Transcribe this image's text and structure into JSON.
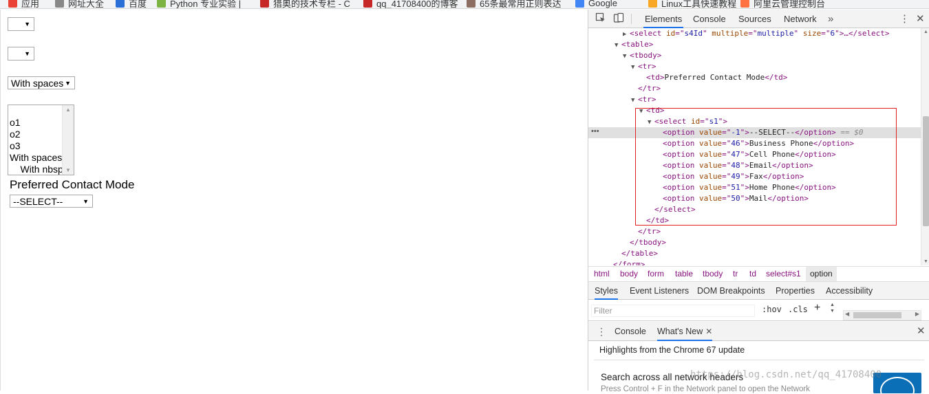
{
  "bookmarks": [
    {
      "label": "应用",
      "icon": "apps-icon"
    },
    {
      "label": "网址大全",
      "icon": "page-icon"
    },
    {
      "label": "百度",
      "icon": "baidu-icon"
    },
    {
      "label": "Python 专业实验 |",
      "icon": "python-icon"
    },
    {
      "label": "猎奥的技术专栏 - C",
      "icon": "csdn-icon"
    },
    {
      "label": "qq_41708400的博客",
      "icon": "csdn-icon"
    },
    {
      "label": "65条最常用正则表达",
      "icon": "bookmark-icon"
    },
    {
      "label": "Google",
      "icon": "google-icon"
    },
    {
      "label": "Linux工具快速教程",
      "icon": "folder-icon"
    },
    {
      "label": "阿里云管理控制台",
      "icon": "aliyun-icon"
    }
  ],
  "page": {
    "select1": {
      "value": ""
    },
    "select2": {
      "value": ""
    },
    "select3": {
      "value": "With spaces"
    },
    "listbox": {
      "options": [
        "",
        "o1",
        "o2",
        "o3",
        "With spaces",
        "    With nbsp"
      ]
    },
    "label": "Preferred Contact Mode",
    "select_mode": {
      "value": "--SELECT--"
    }
  },
  "devtools": {
    "tabs": [
      "Elements",
      "Console",
      "Sources",
      "Network"
    ],
    "active_tab": "Elements",
    "more_label": "»",
    "kebab_label": "⋮",
    "close_label": "✕",
    "dom_lines": [
      {
        "indent": 4,
        "tri": "▶",
        "tag_open": "<select ",
        "attrs": [
          [
            "id",
            "s4Id"
          ],
          [
            "multiple",
            "multiple"
          ],
          [
            "size",
            "6"
          ]
        ],
        "tail": ">…</select>"
      },
      {
        "indent": 3,
        "tri": "▼",
        "tag_open": "<table>",
        "attrs": [],
        "tail": ""
      },
      {
        "indent": 4,
        "tri": "▼",
        "tag_open": "<tbody>",
        "attrs": [],
        "tail": ""
      },
      {
        "indent": 5,
        "tri": "▼",
        "tag_open": "<tr>",
        "attrs": [],
        "tail": ""
      },
      {
        "indent": 6,
        "tri": "",
        "tag_open": "<td>",
        "attrs": [],
        "text": "Preferred Contact Mode",
        "tail": "</td>"
      },
      {
        "indent": 5,
        "tri": "",
        "tag_open": "</tr>",
        "attrs": [],
        "tail": ""
      },
      {
        "indent": 5,
        "tri": "▼",
        "tag_open": "<tr>",
        "attrs": [],
        "tail": ""
      },
      {
        "indent": 6,
        "tri": "▼",
        "tag_open": "<td>",
        "attrs": [],
        "tail": ""
      },
      {
        "indent": 7,
        "tri": "▼",
        "tag_open": "<select ",
        "attrs": [
          [
            "id",
            "s1"
          ]
        ],
        "tail": ">"
      },
      {
        "indent": 8,
        "tri": "",
        "tag_open": "<option ",
        "attrs": [
          [
            "value",
            "-1"
          ]
        ],
        "text": "--SELECT--",
        "tail": "</option>",
        "selected": true,
        "eq": "== $0"
      },
      {
        "indent": 8,
        "tri": "",
        "tag_open": "<option ",
        "attrs": [
          [
            "value",
            "46"
          ]
        ],
        "text": "Business Phone",
        "tail": "</option>"
      },
      {
        "indent": 8,
        "tri": "",
        "tag_open": "<option ",
        "attrs": [
          [
            "value",
            "47"
          ]
        ],
        "text": "Cell Phone",
        "tail": "</option>"
      },
      {
        "indent": 8,
        "tri": "",
        "tag_open": "<option ",
        "attrs": [
          [
            "value",
            "48"
          ]
        ],
        "text": "Email",
        "tail": "</option>"
      },
      {
        "indent": 8,
        "tri": "",
        "tag_open": "<option ",
        "attrs": [
          [
            "value",
            "49"
          ]
        ],
        "text": "Fax",
        "tail": "</option>"
      },
      {
        "indent": 8,
        "tri": "",
        "tag_open": "<option ",
        "attrs": [
          [
            "value",
            "51"
          ]
        ],
        "text": "Home Phone",
        "tail": "</option>"
      },
      {
        "indent": 8,
        "tri": "",
        "tag_open": "<option ",
        "attrs": [
          [
            "value",
            "50"
          ]
        ],
        "text": "Mail",
        "tail": "</option>"
      },
      {
        "indent": 7,
        "tri": "",
        "tag_open": "</select>",
        "attrs": [],
        "tail": ""
      },
      {
        "indent": 6,
        "tri": "",
        "tag_open": "</td>",
        "attrs": [],
        "tail": ""
      },
      {
        "indent": 5,
        "tri": "",
        "tag_open": "</tr>",
        "attrs": [],
        "tail": ""
      },
      {
        "indent": 4,
        "tri": "",
        "tag_open": "</tbody>",
        "attrs": [],
        "tail": ""
      },
      {
        "indent": 3,
        "tri": "",
        "tag_open": "</table>",
        "attrs": [],
        "tail": ""
      },
      {
        "indent": 2,
        "tri": "",
        "tag_open": "</form>",
        "attrs": [],
        "tail": ""
      }
    ],
    "dots_label": "•••",
    "breadcrumbs": [
      "html",
      "body",
      "form",
      "table",
      "tbody",
      "tr",
      "td",
      "select#s1",
      "option"
    ],
    "subtabs": [
      "Styles",
      "Event Listeners",
      "DOM Breakpoints",
      "Properties",
      "Accessibility"
    ],
    "active_subtab": "Styles",
    "filter_placeholder": "Filter",
    "hov_label": ":hov",
    "cls_label": ".cls",
    "plus_label": "+",
    "drawer_tabs": [
      "Console",
      "What's New"
    ],
    "drawer_active": "What's New",
    "drawer_tab_close": "✕",
    "drawer_close": "✕",
    "highlights": "Highlights from the Chrome 67 update",
    "whatsnew_title": "Search across all network headers",
    "whatsnew_desc": "Press Control + F in the Network panel to open the Network"
  },
  "watermark": "https://blog.csdn.net/qq_41708400",
  "colors": {
    "accent": "#1a73e8",
    "highlight_box": "#e31e1e"
  }
}
